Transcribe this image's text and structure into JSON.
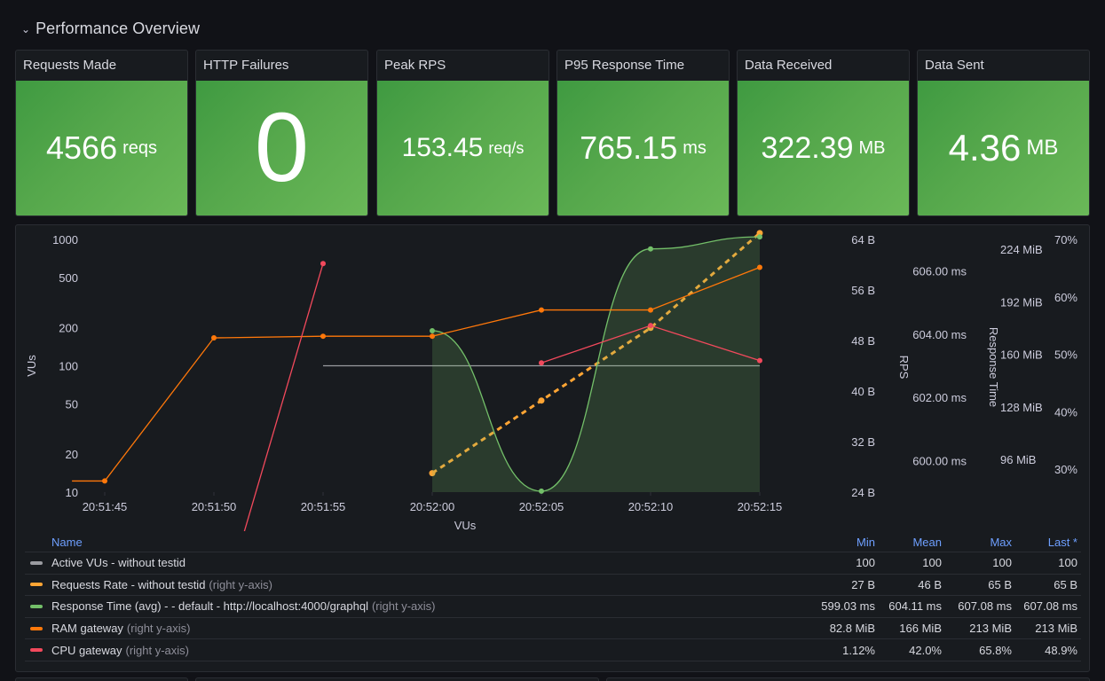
{
  "row": {
    "title": "Performance Overview",
    "chevron_icon": "chevron-down-icon",
    "chevron_glyph": "⌄"
  },
  "stats": [
    {
      "title": "Requests Made",
      "value": "4566",
      "unit": "reqs"
    },
    {
      "title": "HTTP Failures",
      "value": "0",
      "unit": ""
    },
    {
      "title": "Peak RPS",
      "value": "153.45",
      "unit": "req/s"
    },
    {
      "title": "P95 Response Time",
      "value": "765.15",
      "unit": "ms"
    },
    {
      "title": "Data Received",
      "value": "322.39",
      "unit": "MB"
    },
    {
      "title": "Data Sent",
      "value": "4.36",
      "unit": "MB"
    }
  ],
  "colors": {
    "stat_green": "#56a84c",
    "gray": "#9a9ba0",
    "orange": "#ff780a",
    "orange_dashed": "#ffa534",
    "green": "#73bf69",
    "red": "#f2495c",
    "legend_header": "#6e9fff"
  },
  "chart_data": {
    "type": "line",
    "x": [
      "20:51:45",
      "20:51:50",
      "20:51:55",
      "20:52:00",
      "20:52:05",
      "20:52:10",
      "20:52:15"
    ],
    "xlabel": "VUs",
    "axes": {
      "left": {
        "label": "VUs",
        "scale": "log",
        "ticks": [
          10,
          20,
          50,
          100,
          200,
          500,
          1000
        ],
        "range": [
          10,
          1000
        ]
      },
      "rps": {
        "label": "RPS",
        "ticks": [
          "24 B",
          "32 B",
          "40 B",
          "48 B",
          "56 B",
          "64 B"
        ],
        "range": [
          24,
          64
        ]
      },
      "response_time": {
        "label": "Response Time",
        "ticks": [
          "600.00 ms",
          "602.00 ms",
          "604.00 ms",
          "606.00 ms"
        ],
        "range": [
          599,
          607
        ]
      },
      "ram": {
        "label": "",
        "ticks": [
          "96 MiB",
          "128 MiB",
          "160 MiB",
          "192 MiB",
          "224 MiB"
        ],
        "range": [
          76,
          230
        ]
      },
      "cpu": {
        "label": "",
        "ticks": [
          "30%",
          "40%",
          "50%",
          "60%",
          "70%"
        ],
        "range": [
          26,
          70
        ]
      }
    },
    "series": [
      {
        "name": "Active VUs - without testid",
        "axis": "left",
        "color": "#9a9ba0",
        "style": "solid",
        "points": [
          [
            2,
            100
          ],
          [
            6,
            100
          ]
        ]
      },
      {
        "name": "Requests Rate - without testid",
        "axis": "rps",
        "color": "#ffa534",
        "style": "dashed",
        "points": [
          [
            3,
            27
          ],
          [
            4,
            38.5
          ],
          [
            5,
            50
          ],
          [
            6,
            65
          ]
        ]
      },
      {
        "name": "Response Time (avg) - - default - http://localhost:4000/graphql",
        "axis": "response_time",
        "color": "#73bf69",
        "style": "smooth-fill",
        "points": [
          [
            3,
            604.11
          ],
          [
            4,
            599.03
          ],
          [
            5,
            606.7
          ],
          [
            6,
            607.08
          ]
        ]
      },
      {
        "name": "RAM gateway",
        "axis": "ram",
        "color": "#ff780a",
        "style": "solid",
        "points": [
          [
            -0.3,
            82.8
          ],
          [
            0,
            82.8
          ],
          [
            1,
            170
          ],
          [
            2,
            171
          ],
          [
            3,
            171
          ],
          [
            4,
            187
          ],
          [
            5,
            187
          ],
          [
            6,
            213
          ]
        ]
      },
      {
        "name": "CPU gateway",
        "axis": "cpu",
        "color": "#f2495c",
        "style": "solid",
        "points": [
          [
            1,
            1.12
          ],
          [
            2,
            65.8
          ],
          null,
          [
            4,
            48.5
          ],
          [
            5,
            55
          ],
          [
            6,
            48.9
          ]
        ]
      }
    ]
  },
  "legend": {
    "headers": {
      "name": "Name",
      "min": "Min",
      "mean": "Mean",
      "max": "Max",
      "last": "Last *"
    },
    "axis_note": "(right y-axis)",
    "rows": [
      {
        "name": "Active VUs - without testid",
        "right_axis": false,
        "color": "#9a9ba0",
        "min": "100",
        "mean": "100",
        "max": "100",
        "last": "100"
      },
      {
        "name": "Requests Rate - without testid",
        "right_axis": true,
        "color": "#ffa534",
        "min": "27 B",
        "mean": "46 B",
        "max": "65 B",
        "last": "65 B"
      },
      {
        "name": "Response Time (avg) - - default - http://localhost:4000/graphql",
        "right_axis": true,
        "color": "#73bf69",
        "min": "599.03 ms",
        "mean": "604.11 ms",
        "max": "607.08 ms",
        "last": "607.08 ms"
      },
      {
        "name": "RAM gateway",
        "right_axis": true,
        "color": "#ff780a",
        "min": "82.8 MiB",
        "mean": "166 MiB",
        "max": "213 MiB",
        "last": "213 MiB"
      },
      {
        "name": "CPU gateway",
        "right_axis": true,
        "color": "#f2495c",
        "min": "1.12%",
        "mean": "42.0%",
        "max": "65.8%",
        "last": "48.9%"
      }
    ]
  }
}
